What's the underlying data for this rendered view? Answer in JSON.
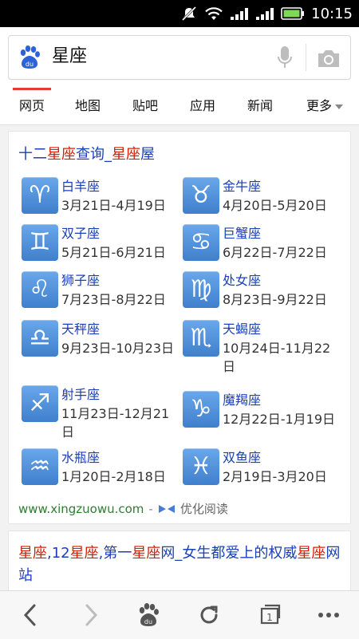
{
  "status": {
    "time": "10:15"
  },
  "search": {
    "query": "星座"
  },
  "tabs": [
    {
      "label": "网页",
      "active": true
    },
    {
      "label": "地图"
    },
    {
      "label": "贴吧"
    },
    {
      "label": "应用"
    },
    {
      "label": "新闻"
    },
    {
      "label": "更多"
    }
  ],
  "result1": {
    "title_parts": [
      "十二",
      "星座",
      "查询_",
      "星座",
      "屋"
    ],
    "zodiacs": [
      {
        "symbol": "♈",
        "name": "白羊座",
        "dates": "3月21日-4月19日"
      },
      {
        "symbol": "♉",
        "name": "金牛座",
        "dates": "4月20日-5月20日"
      },
      {
        "symbol": "♊",
        "name": "双子座",
        "dates": "5月21日-6月21日"
      },
      {
        "symbol": "♋",
        "name": "巨蟹座",
        "dates": "6月22日-7月22日"
      },
      {
        "symbol": "♌",
        "name": "狮子座",
        "dates": "7月23日-8月22日"
      },
      {
        "symbol": "♍",
        "name": "处女座",
        "dates": "8月23日-9月22日"
      },
      {
        "symbol": "♎",
        "name": "天秤座",
        "dates": "9月23日-10月23日"
      },
      {
        "symbol": "♏",
        "name": "天蝎座",
        "dates": "10月24日-11月22日"
      },
      {
        "symbol": "♐",
        "name": "射手座",
        "dates": "11月23日-12月21日"
      },
      {
        "symbol": "♑",
        "name": "魔羯座",
        "dates": "12月22日-1月19日"
      },
      {
        "symbol": "♒",
        "name": "水瓶座",
        "dates": "1月20日-2月18日"
      },
      {
        "symbol": "♓",
        "name": "双鱼座",
        "dates": "2月19日-3月20日"
      }
    ],
    "url": "www.xingzuowu.com",
    "separator": "-",
    "read_label": "优化阅读"
  },
  "result2": {
    "title_parts": [
      "星座",
      ",12",
      "星座",
      ",第一",
      "星座",
      "网_女生都爱上的权威",
      "星座",
      "网站"
    ]
  },
  "bottomnav": {
    "tabs_count": "1"
  },
  "colors": {
    "link": "#1a3fb6",
    "highlight": "#d81e06",
    "url": "#2e7d32",
    "accent_tab": "#e53935"
  }
}
